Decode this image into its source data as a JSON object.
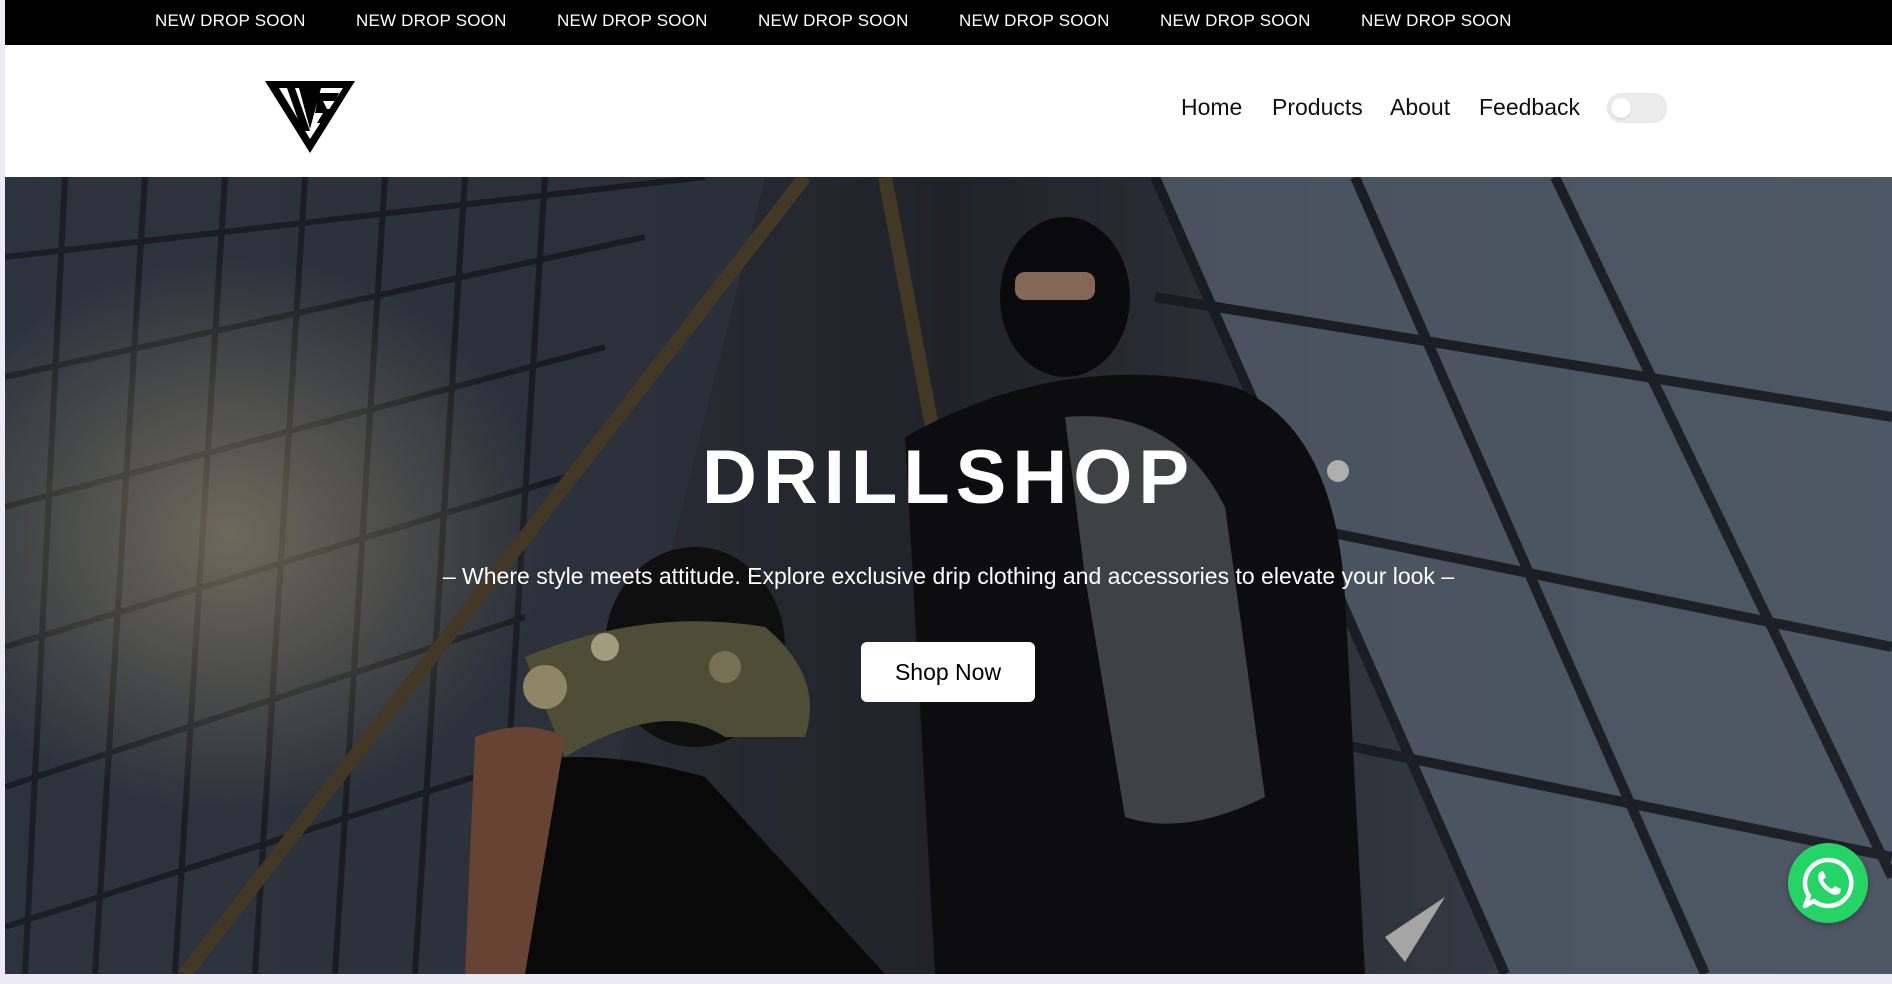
{
  "announcement": {
    "items": [
      "NEW DROP SOON",
      "NEW DROP SOON",
      "NEW DROP SOON",
      "NEW DROP SOON",
      "NEW DROP SOON",
      "NEW DROP SOON",
      "NEW DROP SOON"
    ]
  },
  "header": {
    "logo_icon": "brand-logo-icon",
    "nav": {
      "home": "Home",
      "products": "Products",
      "about": "About",
      "feedback": "Feedback"
    },
    "theme_toggle": {
      "on": false
    }
  },
  "hero": {
    "title": "DRILLSHOP",
    "subtitle": "– Where style meets attitude. Explore exclusive drip clothing and accessories to elevate your look –",
    "cta_label": "Shop Now"
  },
  "whatsapp": {
    "icon": "whatsapp-icon",
    "color": "#25d366"
  }
}
